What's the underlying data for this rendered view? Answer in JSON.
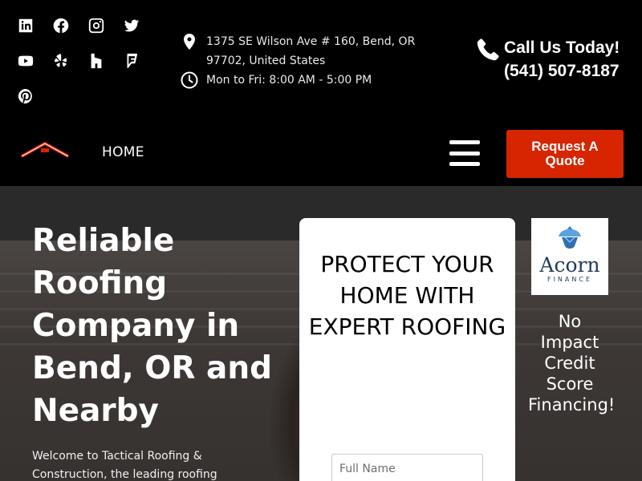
{
  "topbar": {
    "social_icons": [
      "linkedin-icon",
      "facebook-icon",
      "instagram-icon",
      "twitter-icon",
      "youtube-icon",
      "yelp-icon",
      "houzz-icon",
      "foursquare-icon",
      "pinterest-icon"
    ],
    "address": "1375 SE Wilson Ave # 160, Bend, OR 97702, United States",
    "hours": "Mon to Fri: 8:00 AM - 5:00 PM",
    "call_label": "Call Us Today!",
    "phone": "(541) 507-8187"
  },
  "nav": {
    "home_label": "HOME",
    "quote_button": "Request A Quote"
  },
  "hero": {
    "title": "Reliable Roofing Company in Bend, OR and Nearby",
    "description": "Welcome to Tactical Roofing & Construction, the leading roofing"
  },
  "form": {
    "heading": "PROTECT YOUR HOME WITH EXPERT ROOFING",
    "name_placeholder": "Full Name"
  },
  "financing": {
    "brand": "Acorn",
    "brand_sub": "FINANCE",
    "text": "No Impact Credit Score Financing!"
  },
  "colors": {
    "accent": "#d62500",
    "background": "#000000",
    "acorn_blue": "#233d57"
  }
}
